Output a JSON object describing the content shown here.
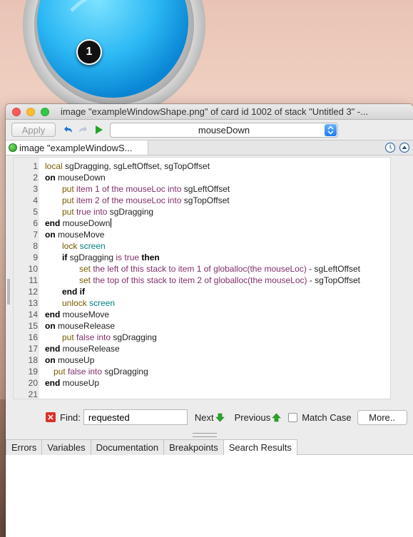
{
  "badge": {
    "number": "1"
  },
  "window": {
    "title": "image \"exampleWindowShape.png\" of card id 1002 of stack \"Untitled 3\" -..."
  },
  "toolbar": {
    "apply_label": "Apply",
    "handler_selected": "mouseDown"
  },
  "script_tab": {
    "label": "image \"exampleWindowS..."
  },
  "code": {
    "lines": [
      {
        "n": "1",
        "indent": 0,
        "parts": [
          {
            "c": "k",
            "t": "local"
          },
          {
            "c": "",
            "t": " sgDragging, sgLeftOffset, sgTopOffset"
          }
        ]
      },
      {
        "n": "2",
        "indent": 0,
        "parts": [
          {
            "c": "ctl",
            "t": "on"
          },
          {
            "c": "",
            "t": " mouseDown"
          }
        ]
      },
      {
        "n": "3",
        "indent": 2,
        "parts": [
          {
            "c": "k",
            "t": "put"
          },
          {
            "c": "p",
            "t": " item 1 of the mouseLoc into"
          },
          {
            "c": "",
            "t": " sgLeftOffset"
          }
        ]
      },
      {
        "n": "4",
        "indent": 2,
        "parts": [
          {
            "c": "k",
            "t": "put"
          },
          {
            "c": "p",
            "t": " item 2 of the mouseLoc into"
          },
          {
            "c": "",
            "t": " sgTopOffset"
          }
        ]
      },
      {
        "n": "5",
        "indent": 2,
        "parts": [
          {
            "c": "k",
            "t": "put"
          },
          {
            "c": "p",
            "t": " true into"
          },
          {
            "c": "",
            "t": " sgDragging"
          }
        ]
      },
      {
        "n": "6",
        "indent": 0,
        "parts": [
          {
            "c": "ctl",
            "t": "end"
          },
          {
            "c": "",
            "t": " mouseDown"
          }
        ],
        "caret": true
      },
      {
        "n": "7",
        "indent": 0,
        "parts": [
          {
            "c": "ctl",
            "t": "on"
          },
          {
            "c": "",
            "t": " mouseMove"
          }
        ]
      },
      {
        "n": "8",
        "indent": 2,
        "parts": [
          {
            "c": "k",
            "t": "lock"
          },
          {
            "c": "t",
            "t": " screen"
          }
        ]
      },
      {
        "n": "9",
        "indent": 2,
        "parts": [
          {
            "c": "ctl",
            "t": "if"
          },
          {
            "c": "",
            "t": " sgDragging "
          },
          {
            "c": "p",
            "t": "is true "
          },
          {
            "c": "ctl",
            "t": "then"
          }
        ]
      },
      {
        "n": "10",
        "indent": 4,
        "parts": [
          {
            "c": "k",
            "t": "set"
          },
          {
            "c": "p",
            "t": " the left of this stack to item 1 of globalloc(the mouseLoc)"
          },
          {
            "c": "",
            "t": " - sgLeftOffset"
          }
        ]
      },
      {
        "n": "11",
        "indent": 4,
        "parts": [
          {
            "c": "k",
            "t": "set"
          },
          {
            "c": "p",
            "t": " the top of this stack to item 2 of globalloc(the mouseLoc)"
          },
          {
            "c": "",
            "t": " - sgTopOffset"
          }
        ]
      },
      {
        "n": "12",
        "indent": 2,
        "parts": [
          {
            "c": "ctl",
            "t": "end if"
          }
        ]
      },
      {
        "n": "13",
        "indent": 2,
        "parts": [
          {
            "c": "k",
            "t": "unlock"
          },
          {
            "c": "t",
            "t": " screen"
          }
        ]
      },
      {
        "n": "14",
        "indent": 0,
        "parts": [
          {
            "c": "ctl",
            "t": "end"
          },
          {
            "c": "",
            "t": " mouseMove"
          }
        ]
      },
      {
        "n": "15",
        "indent": 0,
        "parts": [
          {
            "c": "ctl",
            "t": "on"
          },
          {
            "c": "",
            "t": " mouseRelease"
          }
        ]
      },
      {
        "n": "16",
        "indent": 2,
        "parts": [
          {
            "c": "k",
            "t": "put"
          },
          {
            "c": "p",
            "t": " false into"
          },
          {
            "c": "",
            "t": " sgDragging"
          }
        ]
      },
      {
        "n": "17",
        "indent": 0,
        "parts": [
          {
            "c": "ctl",
            "t": "end"
          },
          {
            "c": "",
            "t": " mouseRelease"
          }
        ]
      },
      {
        "n": "18",
        "indent": 0,
        "parts": [
          {
            "c": "ctl",
            "t": "on"
          },
          {
            "c": "",
            "t": " mouseUp"
          }
        ]
      },
      {
        "n": "19",
        "indent": 1,
        "parts": [
          {
            "c": "k",
            "t": "put"
          },
          {
            "c": "p",
            "t": " false into"
          },
          {
            "c": "",
            "t": " sgDragging"
          }
        ]
      },
      {
        "n": "20",
        "indent": 0,
        "parts": [
          {
            "c": "ctl",
            "t": "end"
          },
          {
            "c": "",
            "t": " mouseUp"
          }
        ]
      },
      {
        "n": "21",
        "indent": 0,
        "parts": []
      }
    ]
  },
  "find": {
    "label": "Find:",
    "value": "requested",
    "next_label": "Next",
    "previous_label": "Previous",
    "match_case_label": "Match Case",
    "more_label": "More.."
  },
  "bottom_tabs": [
    {
      "label": "Errors",
      "active": false
    },
    {
      "label": "Variables",
      "active": false
    },
    {
      "label": "Documentation",
      "active": false
    },
    {
      "label": "Breakpoints",
      "active": false
    },
    {
      "label": "Search Results",
      "active": true
    }
  ]
}
